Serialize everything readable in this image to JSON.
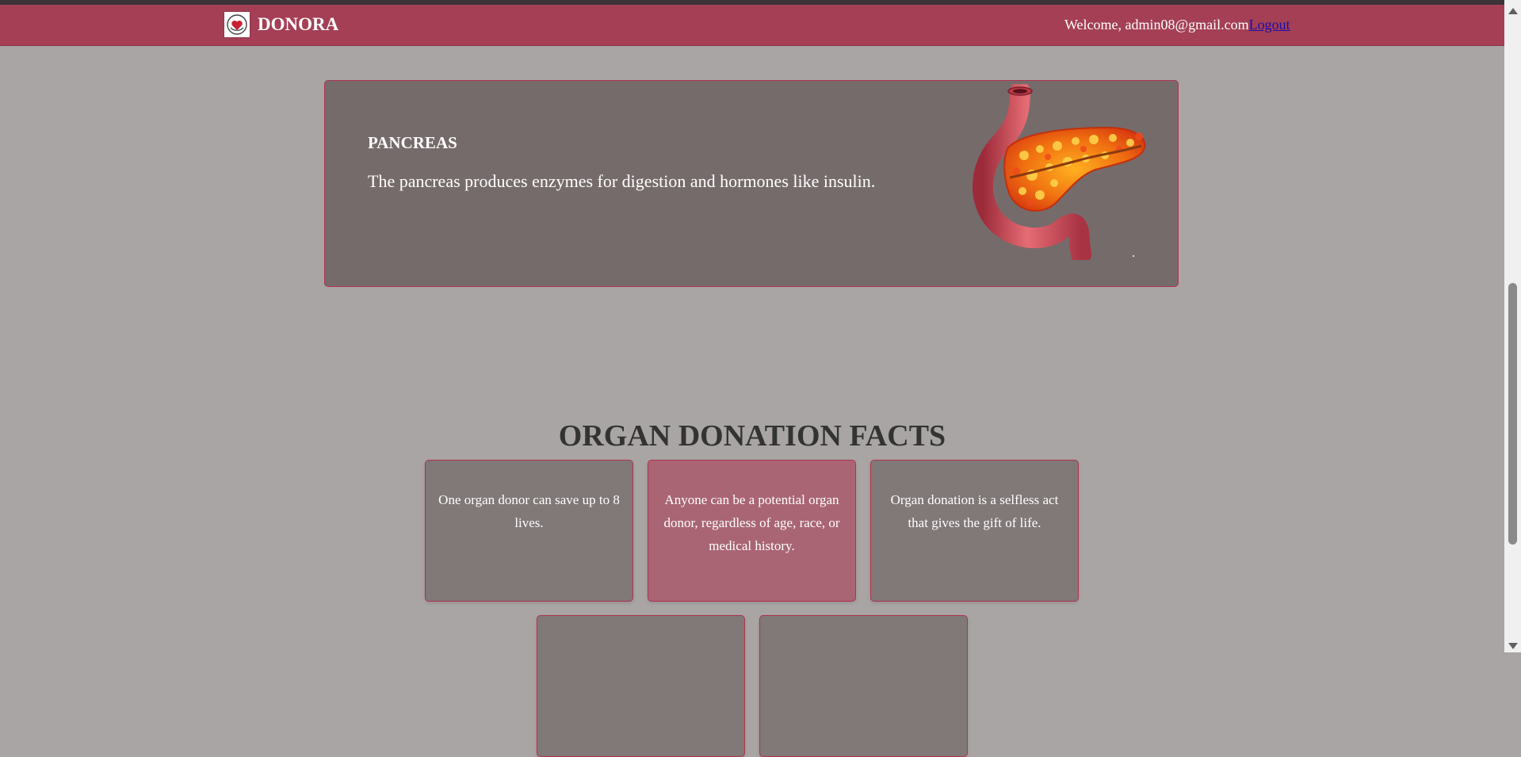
{
  "header": {
    "brand": "DONORA",
    "welcome": "Welcome, admin08@gmail.com",
    "logout": "Logout"
  },
  "organ": {
    "title": "PANCREAS",
    "description": "The pancreas produces enzymes for digestion and hormones like insulin.",
    "icon": "pancreas-illustration"
  },
  "facts": {
    "heading": "ORGAN DONATION FACTS",
    "items": [
      "One organ donor can save up to 8 lives.",
      "Anyone can be a potential organ donor, regardless of age, race, or medical history.",
      "Organ donation is a selfless act that gives the gift of life.",
      "",
      ""
    ]
  },
  "colors": {
    "navbar": "#a43f55",
    "page_background": "#a9a5a4",
    "card_background": "#766b6b",
    "fact_background": "#817878",
    "fact_highlight": "#a96574"
  }
}
